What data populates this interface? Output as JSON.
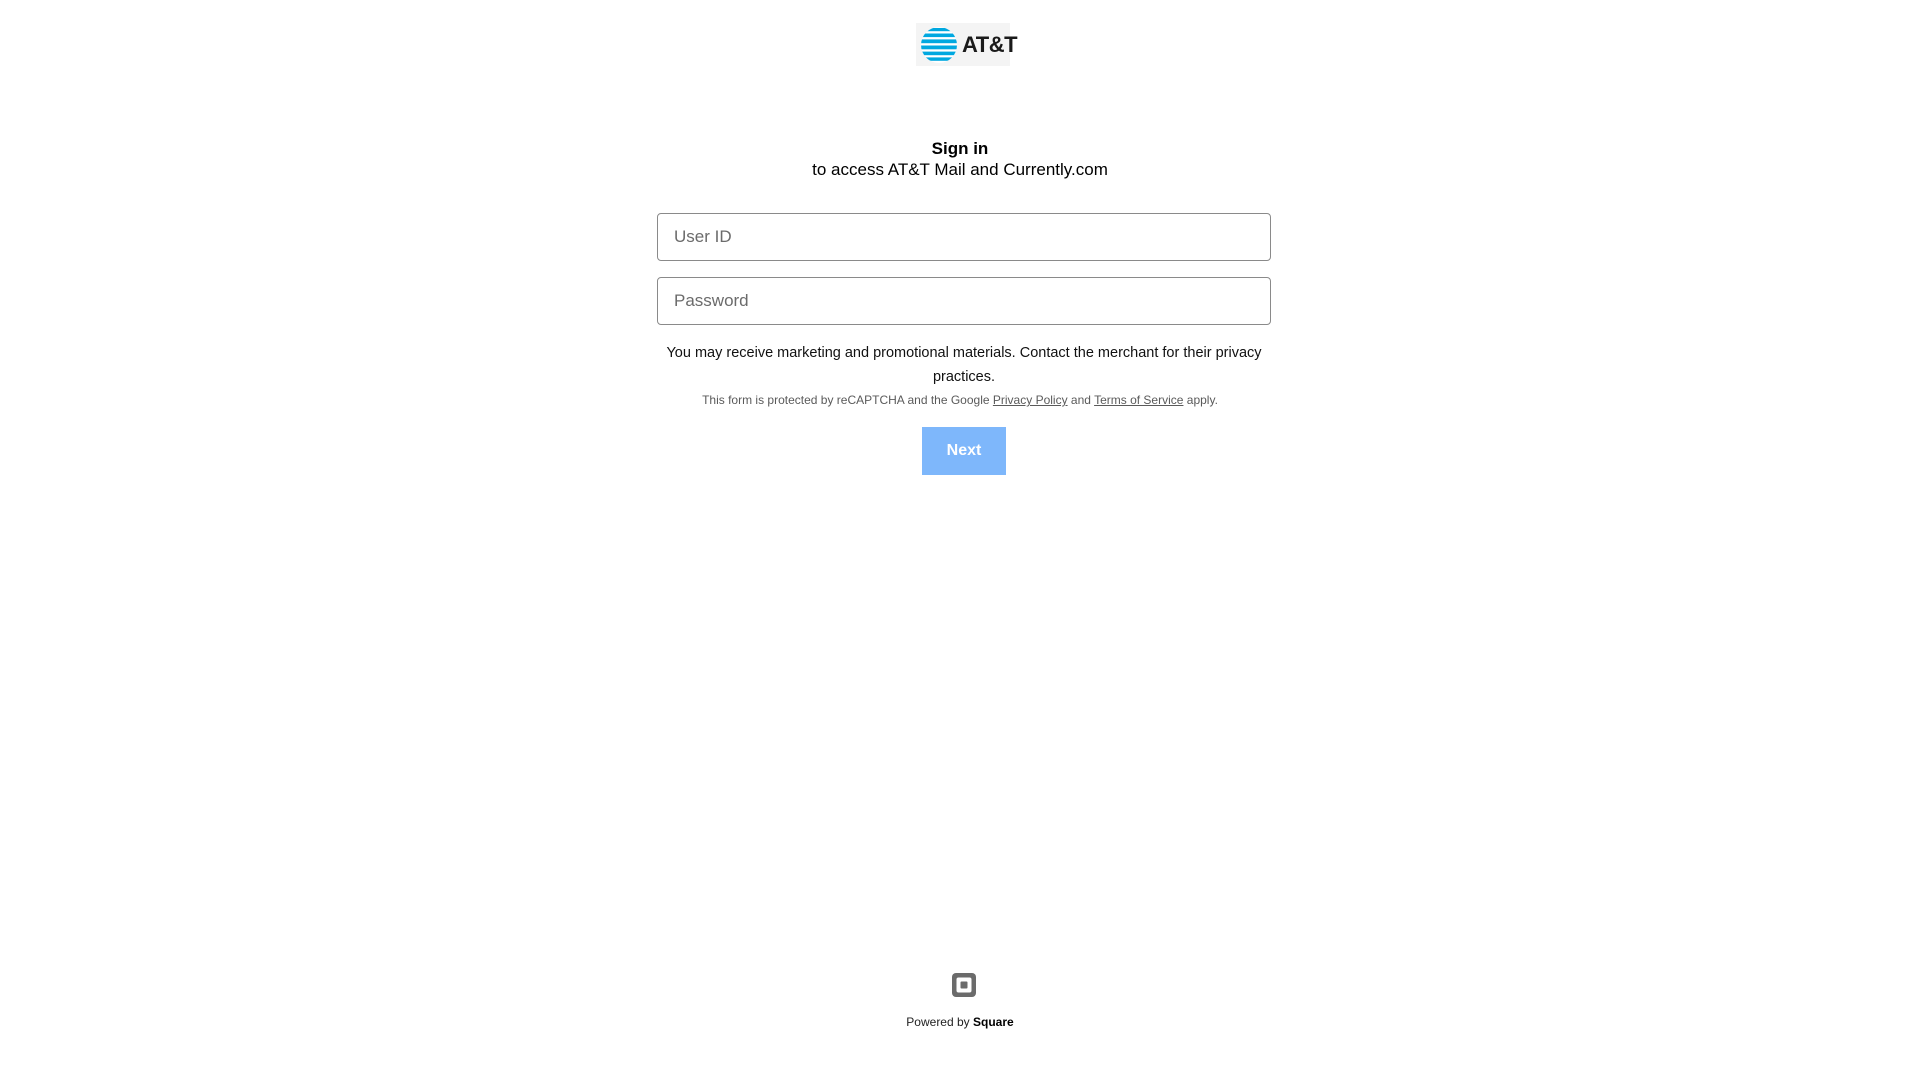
{
  "brand": {
    "logo_text": "AT&T",
    "logo_icon": "att-globe-icon",
    "accent_color": "#00a8e0"
  },
  "header": {
    "title": "Sign in",
    "subtitle": "to access AT&T Mail and Currently.com"
  },
  "form": {
    "user_id_placeholder": "User ID",
    "user_id_value": "",
    "password_placeholder": "Password",
    "password_value": "",
    "notice": "You may receive marketing and promotional materials. Contact the merchant for their privacy practices.",
    "recaptcha_prefix": "This form is protected by reCAPTCHA and the Google",
    "privacy_policy_link": "Privacy Policy",
    "recaptcha_and": "and",
    "terms_link": "Terms of Service",
    "recaptcha_suffix": "apply.",
    "next_label": "Next",
    "next_button_color": "#7eb7fb"
  },
  "footer": {
    "icon": "square-logo-icon",
    "powered_prefix": "Powered by",
    "powered_brand": "Square"
  }
}
